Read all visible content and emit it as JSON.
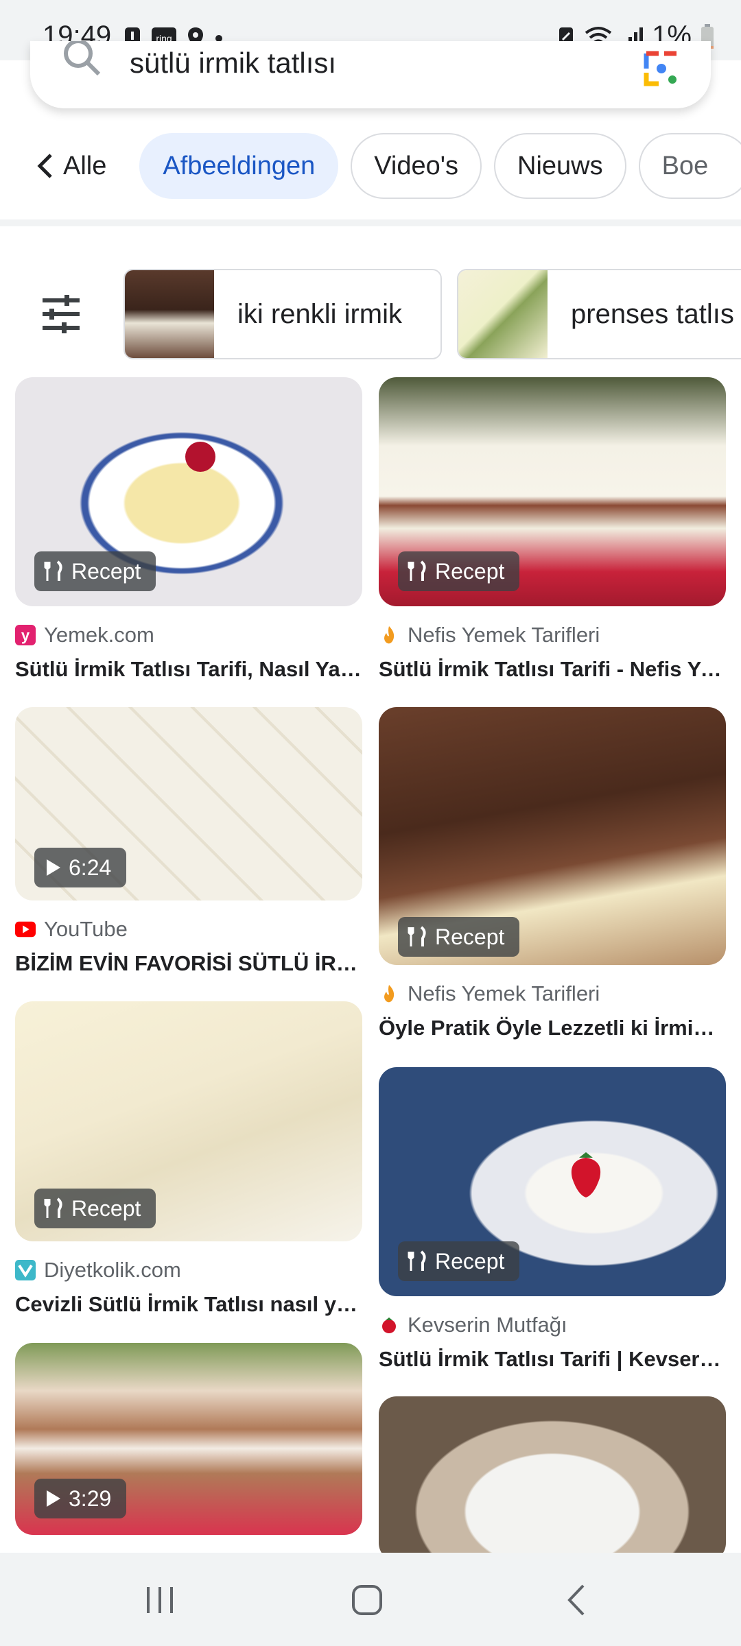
{
  "status_bar": {
    "time": "19:49",
    "battery": "1%"
  },
  "search": {
    "query": "sütlü irmik tatlısı"
  },
  "tabs": {
    "back": "Alle",
    "images": "Afbeeldingen",
    "videos": "Video's",
    "news": "Nieuws",
    "books": "Boe"
  },
  "suggestions": [
    {
      "label": "iki renkli irmik"
    },
    {
      "label": "prenses tatlıs"
    }
  ],
  "results": [
    {
      "badge": "Recept",
      "source": "Yemek.com",
      "title": "Sütlü İrmik Tatlısı Tarifi, Nasıl Yapılır?"
    },
    {
      "badge": "Recept",
      "source": "Nefis Yemek Tarifleri",
      "title": "Sütlü İrmik Tatlısı Tarifi - Nefis Yemek Tarifleri"
    },
    {
      "badge": "6:24",
      "source": "YouTube",
      "title": "BİZİM EVİN FAVORİSİ SÜTLÜ İRMİK TATLISI"
    },
    {
      "badge": "Recept",
      "source": "Nefis Yemek Tarifleri",
      "title": "Öyle Pratik Öyle Lezzetli ki İrmik Tatlısı"
    },
    {
      "badge": "Recept",
      "source": "Diyetkolik.com",
      "title": "Cevizli Sütlü İrmik Tatlısı nasıl yapılır?"
    },
    {
      "badge": "Recept",
      "source": "Kevserin Mutfağı",
      "title": "Sütlü İrmik Tatlısı Tarifi | Kevserin Mutfağı"
    },
    {
      "badge": "3:29",
      "source": "",
      "title": ""
    },
    {
      "badge": "",
      "source": "",
      "title": ""
    }
  ],
  "colors": {
    "accent": "#1a56c4",
    "active_tab_bg": "#e8f0fe",
    "youtube": "#ff0000"
  }
}
